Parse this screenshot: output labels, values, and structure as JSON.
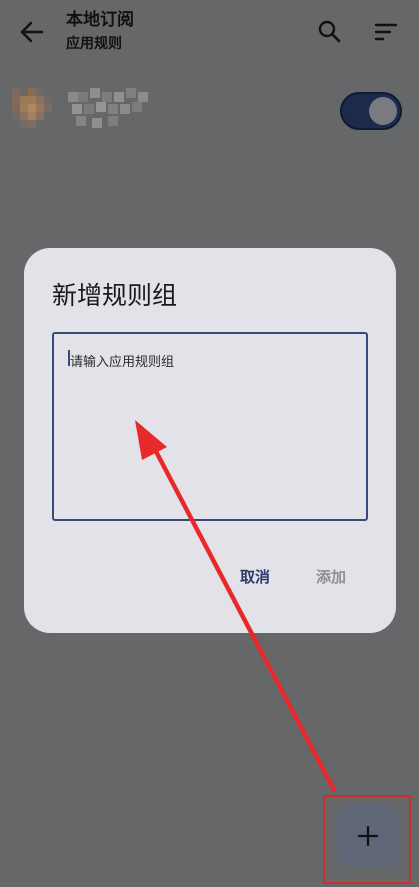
{
  "appbar": {
    "title": "本地订阅",
    "subtitle": "应用规则",
    "back_icon": "arrow-left-icon",
    "search_icon": "search-icon",
    "sort_icon": "sort-icon"
  },
  "app_row": {
    "toggle_on": true
  },
  "dialog": {
    "title": "新增规则组",
    "input": {
      "value": "",
      "placeholder": "请输入应用规则组"
    },
    "cancel_label": "取消",
    "add_label": "添加"
  },
  "fab": {
    "icon": "plus-icon"
  },
  "colors": {
    "scrim": "#666769",
    "dialog_bg": "#e3e2e8",
    "primary": "#2a3c6e",
    "annotation": "#e8292b"
  }
}
